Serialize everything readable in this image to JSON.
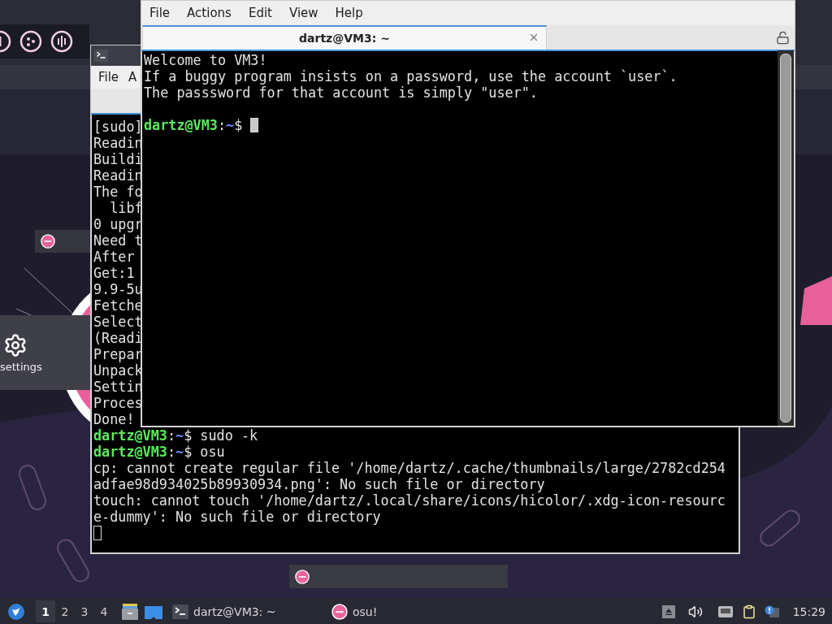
{
  "osu": {
    "settings_label": "settings"
  },
  "back_terminal": {
    "focused": false,
    "menu": [
      "File",
      "A"
    ],
    "lines": [
      {
        "kind": "text",
        "text": "[sudo]"
      },
      {
        "kind": "text",
        "text": "Readin"
      },
      {
        "kind": "text",
        "text": "Buildi"
      },
      {
        "kind": "text",
        "text": "Readin"
      },
      {
        "kind": "text",
        "text": "The fo"
      },
      {
        "kind": "text",
        "text": "  libf"
      },
      {
        "kind": "text",
        "text": "0 upgr"
      },
      {
        "kind": "text",
        "text": "Need t"
      },
      {
        "kind": "text",
        "text": "After"
      },
      {
        "kind": "text",
        "text": "Get:1"
      },
      {
        "kind": "text",
        "text": "9.9-5u"
      },
      {
        "kind": "text",
        "text": "Fetche"
      },
      {
        "kind": "text",
        "text": "Select"
      },
      {
        "kind": "text",
        "text": "(Readi"
      },
      {
        "kind": "text",
        "text": "Prepar"
      },
      {
        "kind": "text",
        "text": "Unpack"
      },
      {
        "kind": "text",
        "text": "Settin"
      },
      {
        "kind": "text",
        "text": "Proces"
      },
      {
        "kind": "text",
        "text": "Done!"
      },
      {
        "kind": "prompt",
        "user": "dartz@VM3",
        "sep": ":",
        "path": "~",
        "rest": "$ sudo -k",
        "cursor": false
      },
      {
        "kind": "prompt",
        "user": "dartz@VM3",
        "sep": ":",
        "path": "~",
        "rest": "$ osu",
        "cursor": false
      },
      {
        "kind": "text",
        "text": "cp: cannot create regular file '/home/dartz/.cache/thumbnails/large/2782cd254"
      },
      {
        "kind": "text",
        "text": "adfae98d934025b89930934.png': No such file or directory"
      },
      {
        "kind": "text",
        "text": "touch: cannot touch '/home/dartz/.local/share/icons/hicolor/.xdg-icon-resourc"
      },
      {
        "kind": "text",
        "text": "e-dummy': No such file or directory"
      },
      {
        "kind": "cursor"
      }
    ]
  },
  "front_terminal": {
    "focused": true,
    "menu": [
      "File",
      "Actions",
      "Edit",
      "View",
      "Help"
    ],
    "tab": {
      "title": "dartz@VM3: ~",
      "selected": true
    },
    "lines": [
      {
        "kind": "text",
        "text": "Welcome to VM3!"
      },
      {
        "kind": "text",
        "text": "If a buggy program insists on a password, use the account `user`."
      },
      {
        "kind": "text",
        "text": "The passsword for that account is simply \"user\"."
      },
      {
        "kind": "blank"
      },
      {
        "kind": "prompt",
        "user": "dartz@VM3",
        "sep": ":",
        "path": "~",
        "rest": "$ ",
        "cursor": true
      }
    ]
  },
  "taskbar": {
    "workspaces": [
      {
        "label": "1",
        "selected": true
      },
      {
        "label": "2",
        "selected": false
      },
      {
        "label": "3",
        "selected": false
      },
      {
        "label": "4",
        "selected": false
      }
    ],
    "tasks": [
      {
        "kind": "terminal",
        "label": "dartz@VM3: ~"
      },
      {
        "kind": "osu",
        "label": "osu!"
      }
    ],
    "clock": "15:29"
  }
}
